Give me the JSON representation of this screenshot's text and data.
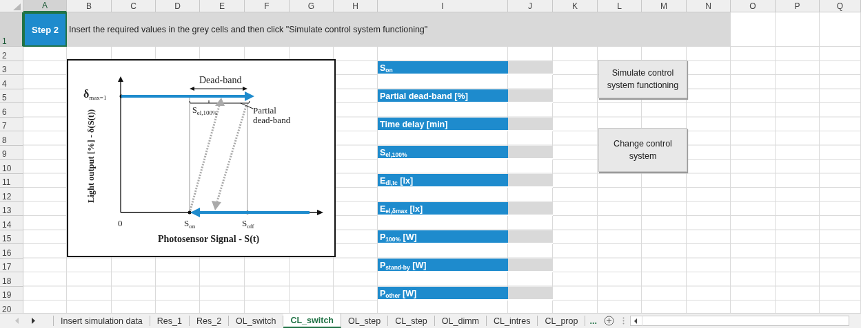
{
  "columns": [
    "A",
    "B",
    "C",
    "D",
    "E",
    "F",
    "G",
    "H",
    "I",
    "J",
    "K",
    "L",
    "M",
    "N",
    "O",
    "P",
    "Q"
  ],
  "rows": [
    "1",
    "2",
    "3",
    "4",
    "5",
    "6",
    "7",
    "8",
    "9",
    "10",
    "11",
    "12",
    "13",
    "14",
    "15",
    "16",
    "17",
    "18",
    "19",
    "20"
  ],
  "step": {
    "label": "Step 2",
    "selected": true
  },
  "instruction": "Insert the required values in the grey cells and then click \"Simulate control system functioning\"",
  "diagram": {
    "dead_band": "Dead-band",
    "delta_max": "**δ**$_{max=1}$",
    "s_el": "S$_{el,100%}$",
    "partial": "Partial dead-band",
    "y_axis_label": "Light output [%] - δ(S(t))",
    "origin": "0",
    "s_on": "S$_{on}$",
    "s_off": "S$_{off}$",
    "x_axis_label": "Photosensor Signal - S(t)"
  },
  "inputs": [
    {
      "label": "S$_{on}$"
    },
    {
      "label": "Partial dead-band [%]"
    },
    {
      "label": "Time delay [min]"
    },
    {
      "label": "S$_{el,100%}$"
    },
    {
      "label": "E$_{dl,tc}$ [lx]"
    },
    {
      "label": "E$_{el,δmax}$ [lx]"
    },
    {
      "label": "P$_{100%}$ [W]"
    },
    {
      "label": "P$_{stand-by}$ [W]"
    },
    {
      "label": "P$_{other}$ [W]"
    }
  ],
  "buttons": [
    "Simulate control system functioning",
    "Change control system"
  ],
  "sheet_tabs": [
    {
      "label": "Insert simulation data",
      "selected": false
    },
    {
      "label": "Res_1",
      "selected": false
    },
    {
      "label": "Res_2",
      "selected": false
    },
    {
      "label": "OL_switch",
      "selected": false
    },
    {
      "label": "CL_switch",
      "selected": true
    },
    {
      "label": "OL_step",
      "selected": false
    },
    {
      "label": "CL_step",
      "selected": false
    },
    {
      "label": "OL_dimm",
      "selected": false
    },
    {
      "label": "CL_intres",
      "selected": false
    },
    {
      "label": "CL_prop",
      "selected": false
    }
  ],
  "more_tabs": "..."
}
